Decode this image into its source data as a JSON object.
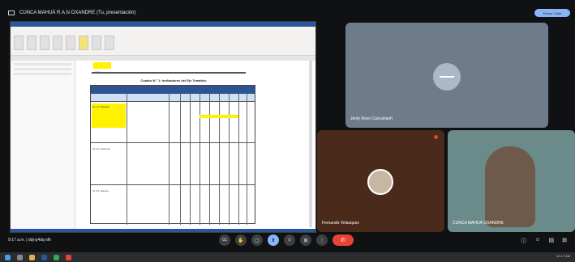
{
  "window": {
    "title": "CUNCA MAHUÁ R.A.N OXANDRE (Tu, presentación)",
    "pill_label": "Entrar / Salir"
  },
  "presentation": {
    "highlighted_note": "texto",
    "table_caption": "Cuadro N.º 1: Indicadores del Eje Temático",
    "row1_text": "Id. 1.1: Mejoras",
    "row2_text": "Id. 2.1: Acciones",
    "row3_text": "Id. 3.1: Apoyos"
  },
  "participants": [
    {
      "name": "Jonty Revo Cancahanh"
    },
    {
      "name": "Fernando Velasquez"
    },
    {
      "name": "CUNCA MAHUÁ OXANDRE"
    }
  ],
  "meeting": {
    "time_and_code": "9:17 a.m. | dqt-p4dq-xfh"
  },
  "controls": [
    {
      "label": "cc"
    },
    {
      "label": "✋"
    },
    {
      "label": "▢"
    },
    {
      "label": "⬆"
    },
    {
      "label": "☺"
    },
    {
      "label": "⊞"
    },
    {
      "label": "⋮"
    }
  ],
  "taskbar": {
    "clock": "10:17 AM"
  }
}
